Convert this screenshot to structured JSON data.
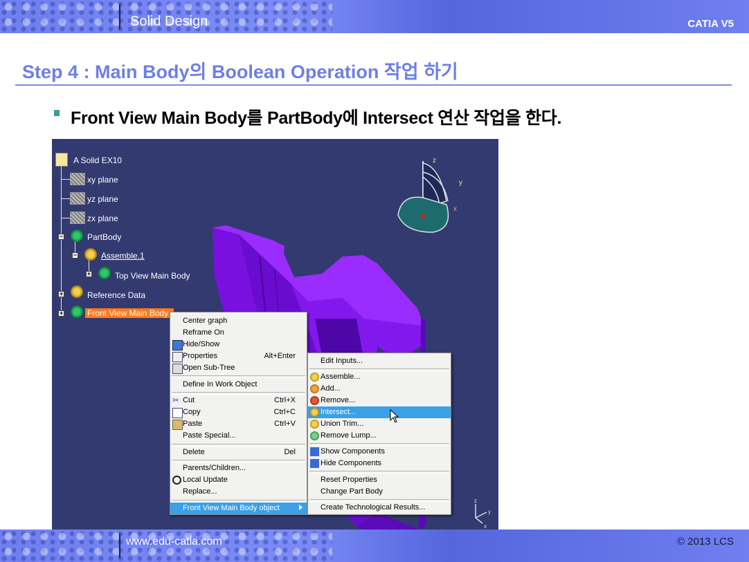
{
  "header": {
    "watermark": "Solid Design",
    "version": "CATIA V5"
  },
  "footer": {
    "url": "www.edu-catia.com",
    "copyright": "© 2013 LCS"
  },
  "slide": {
    "title": "Step 4 : Main Body의 Boolean Operation 작업 하기",
    "bullet": "Front View Main Body를 PartBody에 Intersect 연산 작업을 한다."
  },
  "tree": {
    "root": "A Solid EX10",
    "xy": "xy plane",
    "yz": "yz plane",
    "zx": "zx plane",
    "partbody": "PartBody",
    "assemble": "Assemble.1",
    "topview": "Top View Main Body",
    "refdata": "Reference Data",
    "frontview": "Front View Main Body"
  },
  "compass": {
    "z": "z",
    "y": "y",
    "x": "x"
  },
  "context_menu": {
    "center_graph": "Center graph",
    "reframe_on": "Reframe On",
    "hide_show": "Hide/Show",
    "properties": "Properties",
    "properties_sc": "Alt+Enter",
    "open_subtree": "Open Sub-Tree",
    "define_in_work": "Define In Work Object",
    "cut": "Cut",
    "cut_sc": "Ctrl+X",
    "copy": "Copy",
    "copy_sc": "Ctrl+C",
    "paste": "Paste",
    "paste_sc": "Ctrl+V",
    "paste_special": "Paste Special...",
    "delete": "Delete",
    "delete_sc": "Del",
    "parents_children": "Parents/Children...",
    "local_update": "Local Update",
    "replace": "Replace...",
    "object_submenu": "Front View Main Body object"
  },
  "sub_menu": {
    "edit_inputs": "Edit Inputs...",
    "assemble": "Assemble...",
    "add": "Add...",
    "remove": "Remove...",
    "intersect": "Intersect...",
    "union_trim": "Union Trim...",
    "remove_lump": "Remove Lump...",
    "show_components": "Show Components",
    "hide_components": "Hide Components",
    "reset_properties": "Reset Properties",
    "change_part_body": "Change Part Body",
    "create_tech_results": "Create Technological Results..."
  },
  "colors": {
    "title": "#6d7fe6",
    "viewport_bg": "#323a70",
    "model": "#8a18f0",
    "selection": "#ff7a1a",
    "menu_highlight": "#3aa0e8"
  }
}
